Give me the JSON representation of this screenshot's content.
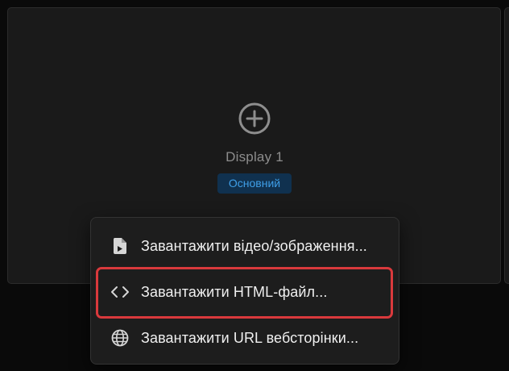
{
  "display": {
    "name": "Display 1",
    "badge": "Основний",
    "add_icon": "plus-circle-icon"
  },
  "menu": {
    "items": [
      {
        "label": "Завантажити відео/зображення...",
        "icon": "file-media-icon"
      },
      {
        "label": "Завантажити HTML-файл...",
        "icon": "code-icon"
      },
      {
        "label": "Завантажити URL вебсторінки...",
        "icon": "globe-icon"
      }
    ]
  },
  "colors": {
    "badge_text": "#3f9fe8",
    "badge_bg": "#10314f",
    "highlight": "#d9393c",
    "menu_bg": "#1d1d1d"
  }
}
